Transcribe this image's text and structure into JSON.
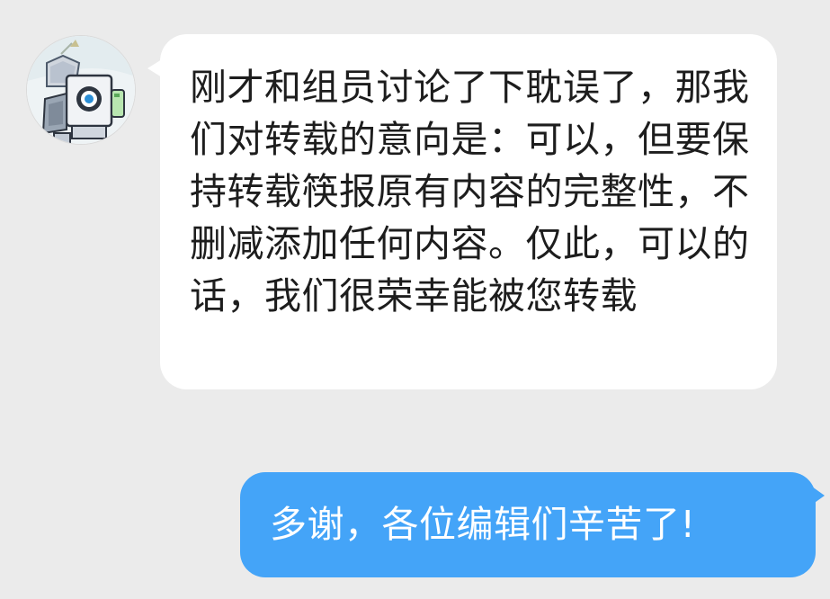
{
  "conversation": {
    "messages": [
      {
        "sender": "other",
        "avatar_icon": "robot-avatar-icon",
        "text": "刚才和组员讨论了下耽误了，那我们对转载的意向是：可以，但要保持转载筷报原有内容的完整性，不删减添加任何内容。仅此，可以的话，我们很荣幸能被您转载"
      },
      {
        "sender": "self",
        "text": "多谢，各位编辑们辛苦了!"
      }
    ]
  },
  "colors": {
    "background": "#ebebeb",
    "incoming_bubble": "#ffffff",
    "outgoing_bubble": "#44a4f8",
    "incoming_text": "#1d1d1d",
    "outgoing_text": "#ffffff"
  }
}
